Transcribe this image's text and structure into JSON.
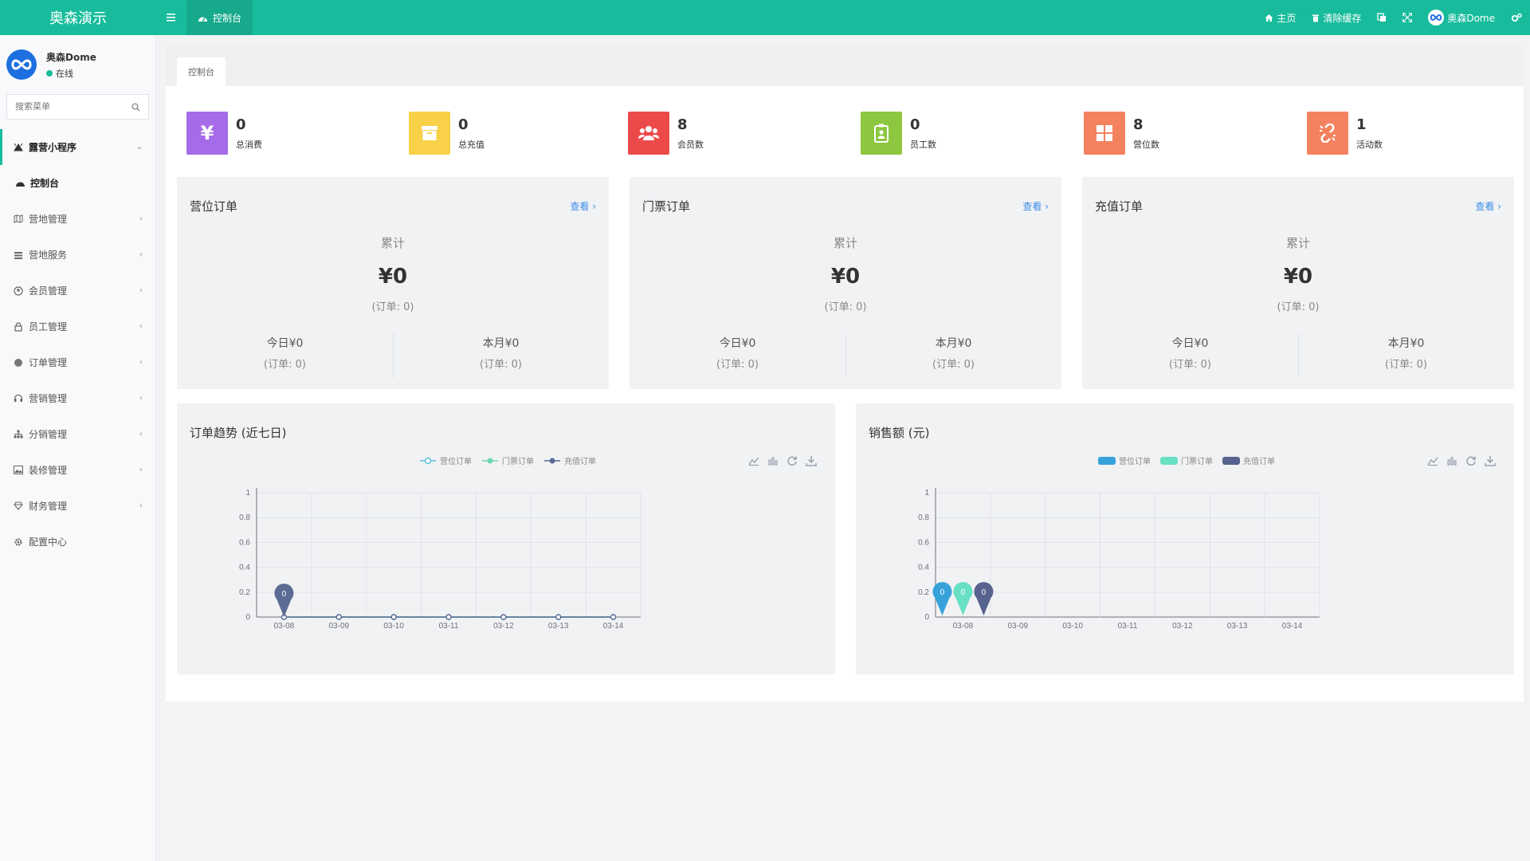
{
  "app": {
    "brand": "奥森演示",
    "menu_toggle_icon": "hamburger-icon",
    "active_tab": "控制台"
  },
  "topbar": {
    "home": "主页",
    "clear_cache": "清除缓存",
    "user_name": "奥森Dome"
  },
  "sidebar": {
    "user_name": "奥森Dome",
    "status": "在线",
    "search_placeholder": "搜索菜单",
    "group_label": "露营小程序",
    "items": [
      {
        "label": "控制台",
        "icon": "dashboard-icon"
      },
      {
        "label": "营地管理",
        "icon": "map-icon"
      },
      {
        "label": "营地服务",
        "icon": "list-icon"
      },
      {
        "label": "会员管理",
        "icon": "user-circle-icon"
      },
      {
        "label": "员工管理",
        "icon": "lock-icon"
      },
      {
        "label": "订单管理",
        "icon": "gear-badge-icon"
      },
      {
        "label": "营销管理",
        "icon": "headset-icon"
      },
      {
        "label": "分销管理",
        "icon": "sitemap-icon"
      },
      {
        "label": "装修管理",
        "icon": "image-icon"
      },
      {
        "label": "财务管理",
        "icon": "diamond-icon"
      },
      {
        "label": "配置中心",
        "icon": "gear-icon"
      }
    ]
  },
  "content": {
    "tab_label": "控制台"
  },
  "stats": [
    {
      "value": "0",
      "label": "总消费",
      "color": "#a56be9",
      "icon": "yen-icon"
    },
    {
      "value": "0",
      "label": "总充值",
      "color": "#f8d148",
      "icon": "archive-icon"
    },
    {
      "value": "8",
      "label": "会员数",
      "color": "#ec4a4a",
      "icon": "users-icon"
    },
    {
      "value": "0",
      "label": "员工数",
      "color": "#8dc63f",
      "icon": "id-badge-icon"
    },
    {
      "value": "8",
      "label": "营位数",
      "color": "#f5825f",
      "icon": "grid-icon"
    },
    {
      "value": "1",
      "label": "活动数",
      "color": "#f5825f",
      "icon": "unlink-icon"
    }
  ],
  "order_cards": [
    {
      "title": "营位订单",
      "link": "查看",
      "total_label": "累计",
      "total": "¥0",
      "total_sub": "(订单: 0)",
      "today": "今日¥0",
      "today_sub": "(订单: 0)",
      "month": "本月¥0",
      "month_sub": "(订单: 0)"
    },
    {
      "title": "门票订单",
      "link": "查看",
      "total_label": "累计",
      "total": "¥0",
      "total_sub": "(订单: 0)",
      "today": "今日¥0",
      "today_sub": "(订单: 0)",
      "month": "本月¥0",
      "month_sub": "(订单: 0)"
    },
    {
      "title": "充值订单",
      "link": "查看",
      "total_label": "累计",
      "total": "¥0",
      "total_sub": "(订单: 0)",
      "today": "今日¥0",
      "today_sub": "(订单: 0)",
      "month": "本月¥0",
      "month_sub": "(订单: 0)"
    }
  ],
  "chart_data": [
    {
      "type": "line",
      "title": "订单趋势 (近七日)",
      "x": [
        "03-08",
        "03-09",
        "03-10",
        "03-11",
        "03-12",
        "03-13",
        "03-14"
      ],
      "ylim": [
        0,
        1
      ],
      "yticks": [
        "0",
        "0.2",
        "0.4",
        "0.6",
        "0.8",
        "1"
      ],
      "series": [
        {
          "name": "营位订单",
          "color": "#5bc0de",
          "values": [
            0,
            0,
            0,
            0,
            0,
            0,
            0
          ]
        },
        {
          "name": "门票订单",
          "color": "#6fd7b3",
          "values": [
            0,
            0,
            0,
            0,
            0,
            0,
            0
          ]
        },
        {
          "name": "充值订单",
          "color": "#5b6b93",
          "values": [
            0,
            0,
            0,
            0,
            0,
            0,
            0
          ]
        }
      ],
      "pin_label": "0",
      "grid": true,
      "legend": "top"
    },
    {
      "type": "bar",
      "title": "销售额 (元)",
      "x": [
        "03-08",
        "03-09",
        "03-10",
        "03-11",
        "03-12",
        "03-13",
        "03-14"
      ],
      "ylim": [
        0,
        1
      ],
      "yticks": [
        "0",
        "0.2",
        "0.4",
        "0.6",
        "0.8",
        "1"
      ],
      "series": [
        {
          "name": "营位订单",
          "color": "#37a2da",
          "values": [
            0,
            0,
            0,
            0,
            0,
            0,
            0
          ]
        },
        {
          "name": "门票订单",
          "color": "#67e0c3",
          "values": [
            0,
            0,
            0,
            0,
            0,
            0,
            0
          ]
        },
        {
          "name": "充值订单",
          "color": "#56638e",
          "values": [
            0,
            0,
            0,
            0,
            0,
            0,
            0
          ]
        }
      ],
      "pin_labels": [
        "0",
        "0",
        "0"
      ],
      "grid": true,
      "legend": "top"
    }
  ]
}
